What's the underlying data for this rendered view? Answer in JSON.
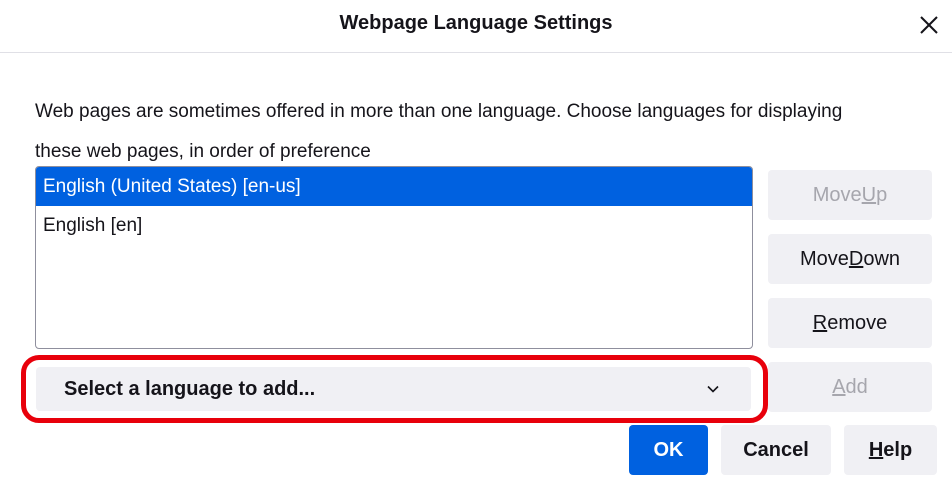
{
  "dialog": {
    "title": "Webpage Language Settings",
    "close_icon": "close-icon",
    "description_line1": "Web pages are sometimes offered in more than one language. Choose languages for displaying",
    "description_line2": "these web pages, in order of preference"
  },
  "languages": {
    "items": [
      {
        "label": "English (United States) [en-us]",
        "selected": true
      },
      {
        "label": "English [en]",
        "selected": false
      }
    ]
  },
  "buttons": {
    "move_up": {
      "pre": "Move ",
      "key": "U",
      "post": "p",
      "enabled": false
    },
    "move_down": {
      "pre": "Move ",
      "key": "D",
      "post": "own",
      "enabled": true
    },
    "remove": {
      "pre": "",
      "key": "R",
      "post": "emove",
      "enabled": true
    },
    "add": {
      "pre": "",
      "key": "A",
      "post": "dd",
      "enabled": false
    },
    "ok": "OK",
    "cancel": "Cancel",
    "help": {
      "pre": "",
      "key": "H",
      "post": "elp"
    }
  },
  "select": {
    "placeholder": "Select a language to add...",
    "icon": "chevron-down-icon"
  },
  "colors": {
    "accent": "#0061e0",
    "highlight_outline": "#e8000b",
    "button_bg": "#f0f0f4",
    "disabled_text": "#a6a6ad"
  }
}
